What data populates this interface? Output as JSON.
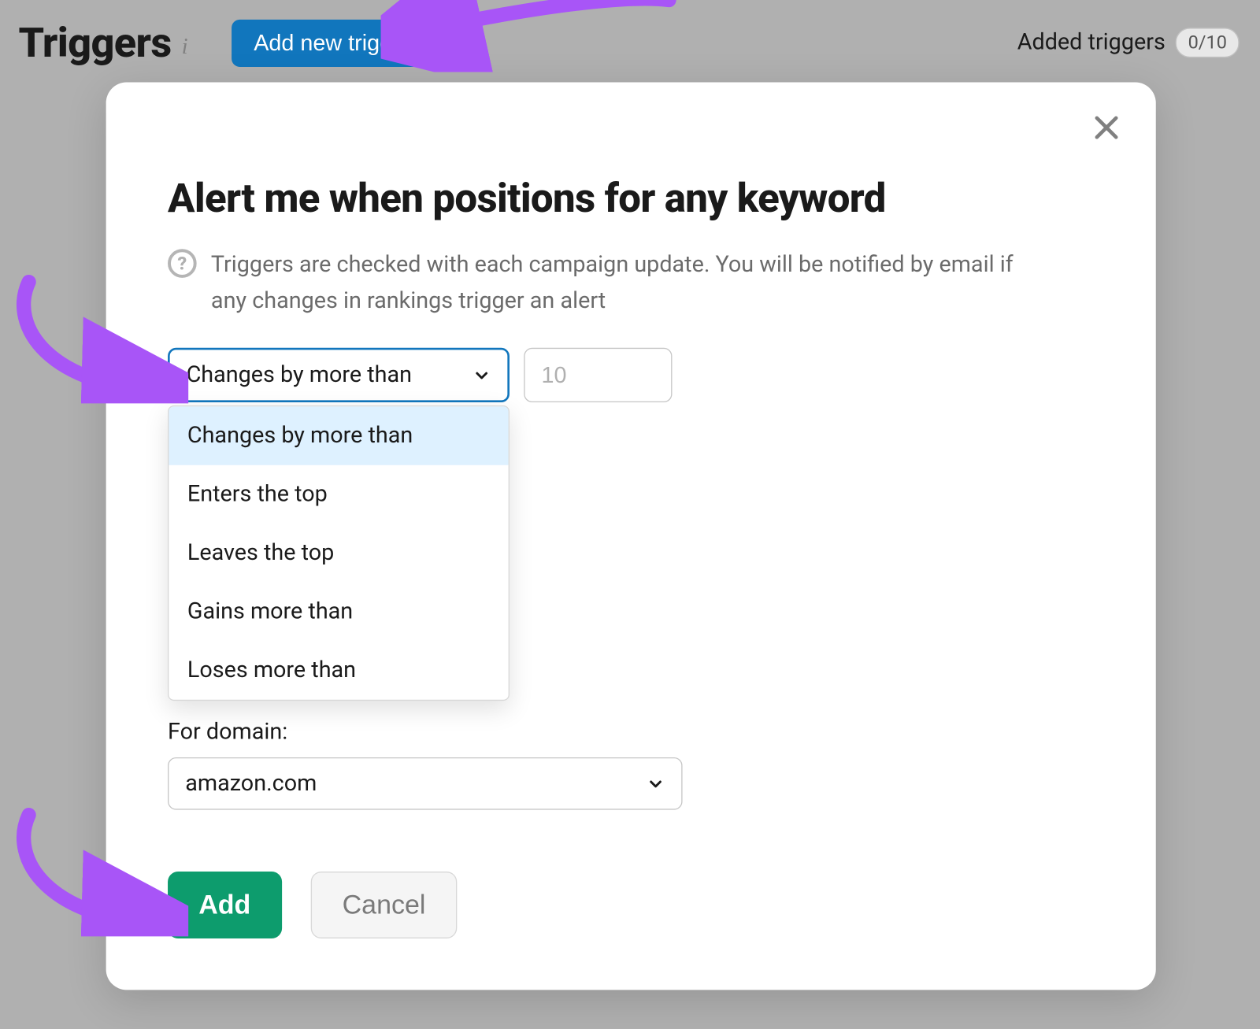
{
  "header": {
    "title": "Triggers",
    "add_button": "Add new trigger",
    "added_label": "Added triggers",
    "count": "0/10"
  },
  "modal": {
    "title": "Alert me when positions for any keyword",
    "helper": "Triggers are checked with each campaign update. You will be notified by email if any changes in rankings trigger an alert",
    "condition_selected": "Changes by more than",
    "value_placeholder": "10",
    "options": [
      "Changes by more than",
      "Enters the top",
      "Leaves the top",
      "Gains more than",
      "Loses more than"
    ],
    "domain_label": "For domain:",
    "domain_value": "amazon.com",
    "add_btn": "Add",
    "cancel_btn": "Cancel"
  }
}
